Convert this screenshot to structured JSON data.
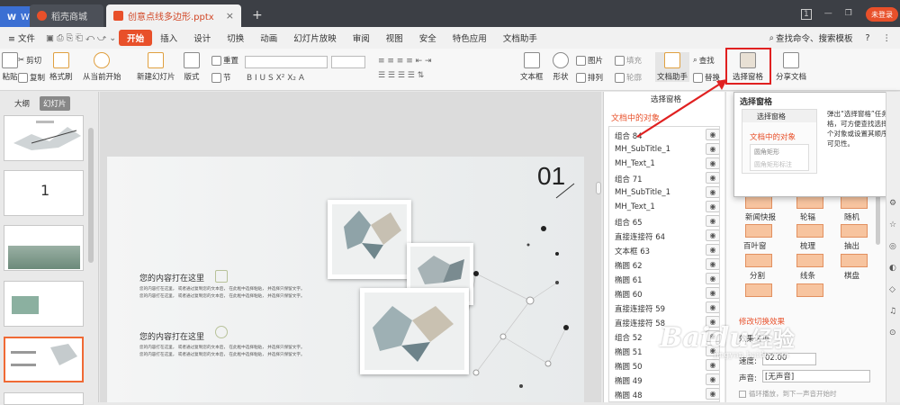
{
  "titlebar": {
    "wps_tab": "WPS",
    "tab2": "稻壳商城",
    "tab3": "创意点线多边形.pptx",
    "close_tab": "×",
    "new_tab": "+",
    "login": "未登录",
    "win_controls": [
      "1",
      "—",
      "❐",
      "✕"
    ]
  },
  "menubar": {
    "file": "≡ 文件",
    "items": [
      "开始",
      "插入",
      "设计",
      "切换",
      "动画",
      "幻灯片放映",
      "审阅",
      "视图",
      "安全",
      "特色应用",
      "文档助手"
    ],
    "search": "查找命令、搜索模板",
    "help": "?",
    "more": "⋮"
  },
  "ribbon": {
    "paste": "粘贴",
    "cut": "剪切",
    "copy": "复制",
    "format_brush": "格式刷",
    "play_from_current": "从当前开始",
    "new_slide": "新建幻灯片",
    "layout": "版式",
    "section": "节",
    "reset": "重置",
    "textbox": "文本框",
    "shape": "形状",
    "picture": "图片",
    "arrange": "排列",
    "fill": "填充",
    "outline": "轮廓",
    "doc_assistant": "文档助手",
    "find": "查找",
    "replace": "替换",
    "selection_pane": "选择窗格",
    "share_doc": "分享文档"
  },
  "leftpanel": {
    "tab_outline": "大纲",
    "tab_slides": "幻灯片",
    "slide_numbers": [
      "01",
      "01",
      "01",
      "01"
    ],
    "thumb2_text": "1"
  },
  "slide": {
    "number": "01",
    "heading1": "您的内容打在这里",
    "body1a": "您的内容打在这里，  或者通过复制您的文本后，  在此框中选择粘贴，  并选择只保留文字。",
    "body1b": "您的内容打在这里，  或者通过复制您的文本后，  在此框中选择粘贴，  并选择只保留文字。",
    "heading2": "您的内容打在这里",
    "body2a": "您的内容打在这里，  或者通过复制您的文本后，  在此框中选择粘贴，  并选择只保留文字。",
    "body2b": "您的内容打在这里，  或者通过复制您的文本后，  在此框中选择粘贴，  并选择只保留文字。"
  },
  "selpane": {
    "title": "选择窗格",
    "subtitle": "文档中的对象",
    "objects": [
      "组合 84",
      "MH_SubTitle_1",
      "MH_Text_1",
      "组合 71",
      "MH_SubTitle_1",
      "MH_Text_1",
      "组合 65",
      "直接连接符 64",
      "文本框 63",
      "椭圆 62",
      "椭圆 61",
      "椭圆 60",
      "直接连接符 59",
      "直接连接符 58",
      "组合 52",
      "椭圆 51",
      "椭圆 50",
      "椭圆 49",
      "椭圆 48"
    ]
  },
  "popup": {
    "title": "选择窗格",
    "mini_tab": "选择窗格",
    "mini_sub": "文档中的对象",
    "mini_item1": "圆角矩形",
    "mini_item2": "圆角矩形标注",
    "desc": "弹出“选择窗格”任务窗格，可方便查找选择单个对象或设置其顺序和可见性。"
  },
  "rightpanel": {
    "anims": [
      "新闻快报",
      "轮辐",
      "随机",
      "百叶窗",
      "梳理",
      "抽出",
      "分割",
      "线条",
      "棋盘"
    ],
    "section": "修改切换效果",
    "effect_label": "效果选项",
    "speed_label": "速度:",
    "speed_value": "02.00",
    "sound_label": "声音:",
    "sound_value": "[无声音]",
    "loop_label": "循环播放，到下一声音开始时"
  },
  "watermark": {
    "brand": "Baidu",
    "cn": "经验",
    "url": "jingyan.baidu.com"
  }
}
